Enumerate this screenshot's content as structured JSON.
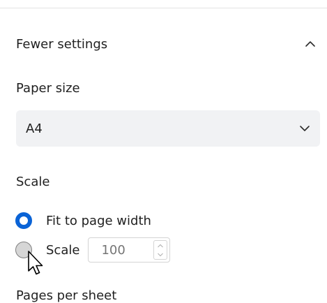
{
  "section_toggle": {
    "label": "Fewer settings",
    "icon": "chevron-up-icon"
  },
  "paper_size": {
    "label": "Paper size",
    "selected": "A4",
    "icon": "chevron-down-icon"
  },
  "scale": {
    "label": "Scale",
    "options": [
      {
        "label": "Fit to page width",
        "checked": true
      },
      {
        "label": "Scale",
        "checked": false
      }
    ],
    "value_placeholder": "100"
  },
  "pages_per_sheet": {
    "label": "Pages per sheet"
  },
  "colors": {
    "accent": "#0a63d6",
    "select_bg": "#f1f2f4",
    "divider": "#e3e3e3",
    "disabled_text": "#b7b7b7"
  }
}
